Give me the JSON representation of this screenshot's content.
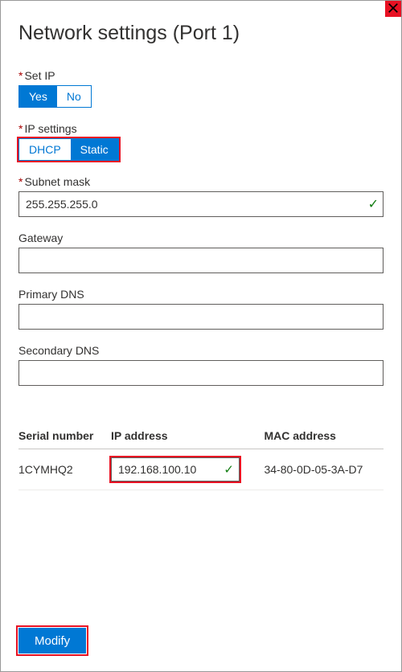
{
  "title": "Network settings (Port 1)",
  "fields": {
    "setIp": {
      "label": "Set IP",
      "options": {
        "yes": "Yes",
        "no": "No"
      },
      "selected": "yes"
    },
    "ipSettings": {
      "label": "IP settings",
      "options": {
        "dhcp": "DHCP",
        "static": "Static"
      },
      "selected": "static"
    },
    "subnetMask": {
      "label": "Subnet mask",
      "value": "255.255.255.0"
    },
    "gateway": {
      "label": "Gateway",
      "value": ""
    },
    "primaryDns": {
      "label": "Primary DNS",
      "value": ""
    },
    "secondaryDns": {
      "label": "Secondary DNS",
      "value": ""
    }
  },
  "table": {
    "headers": {
      "serial": "Serial number",
      "ip": "IP address",
      "mac": "MAC address"
    },
    "row": {
      "serial": "1CYMHQ2",
      "ip": "192.168.100.10",
      "mac": "34-80-0D-05-3A-D7"
    }
  },
  "buttons": {
    "modify": "Modify"
  }
}
